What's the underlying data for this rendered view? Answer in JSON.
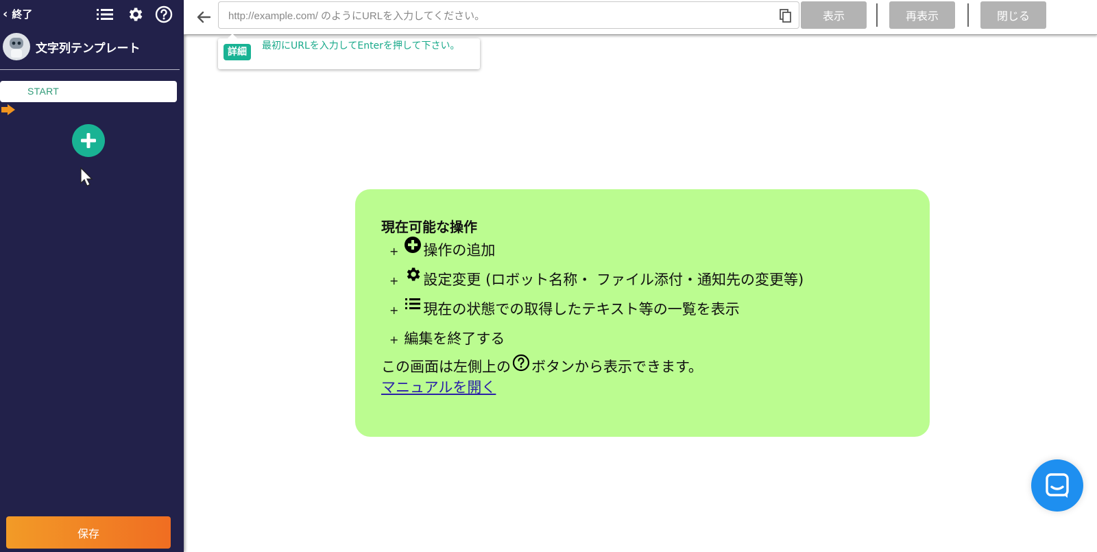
{
  "sidebar": {
    "back_label": "終了",
    "robot_name": "文字列テンプレート",
    "start_label": "START",
    "save_label": "保存",
    "icons": [
      "list-icon",
      "gear-icon",
      "help-icon",
      "plus-icon",
      "arrow-right-icon",
      "robot-avatar"
    ]
  },
  "toolbar": {
    "url_placeholder": "http://example.com/ のようにURLを入力してください。",
    "url_value": "",
    "show_label": "表示",
    "reload_label": "再表示",
    "close_label": "閉じる"
  },
  "tooltip": {
    "badge": "詳細",
    "text": "最初にURLを入力してEnterを押して下さい。"
  },
  "help": {
    "title": "現在可能な操作",
    "items": [
      {
        "prefix": "+",
        "icon": "plus-circle-icon",
        "text": "操作の追加"
      },
      {
        "prefix": "+",
        "icon": "gear-icon",
        "text": "設定変更 (ロボット名称・ ファイル添付・通知先の変更等)"
      },
      {
        "prefix": "+",
        "icon": "list-icon",
        "text": "現在の状態での取得したテキスト等の一覧を表示"
      },
      {
        "prefix": "+",
        "icon": "",
        "text": "編集を終了する"
      }
    ],
    "note_before": "この画面は左側上の",
    "note_after": "ボタンから表示できます。",
    "manual_link": "マニュアルを開く"
  },
  "colors": {
    "sidebar_bg": "#22214a",
    "accent_green": "#19b394",
    "help_bg": "#bbfc90",
    "save_orange": "#f29b27",
    "button_gray": "#b3b3b3",
    "chat_blue": "#1e8ff0"
  }
}
